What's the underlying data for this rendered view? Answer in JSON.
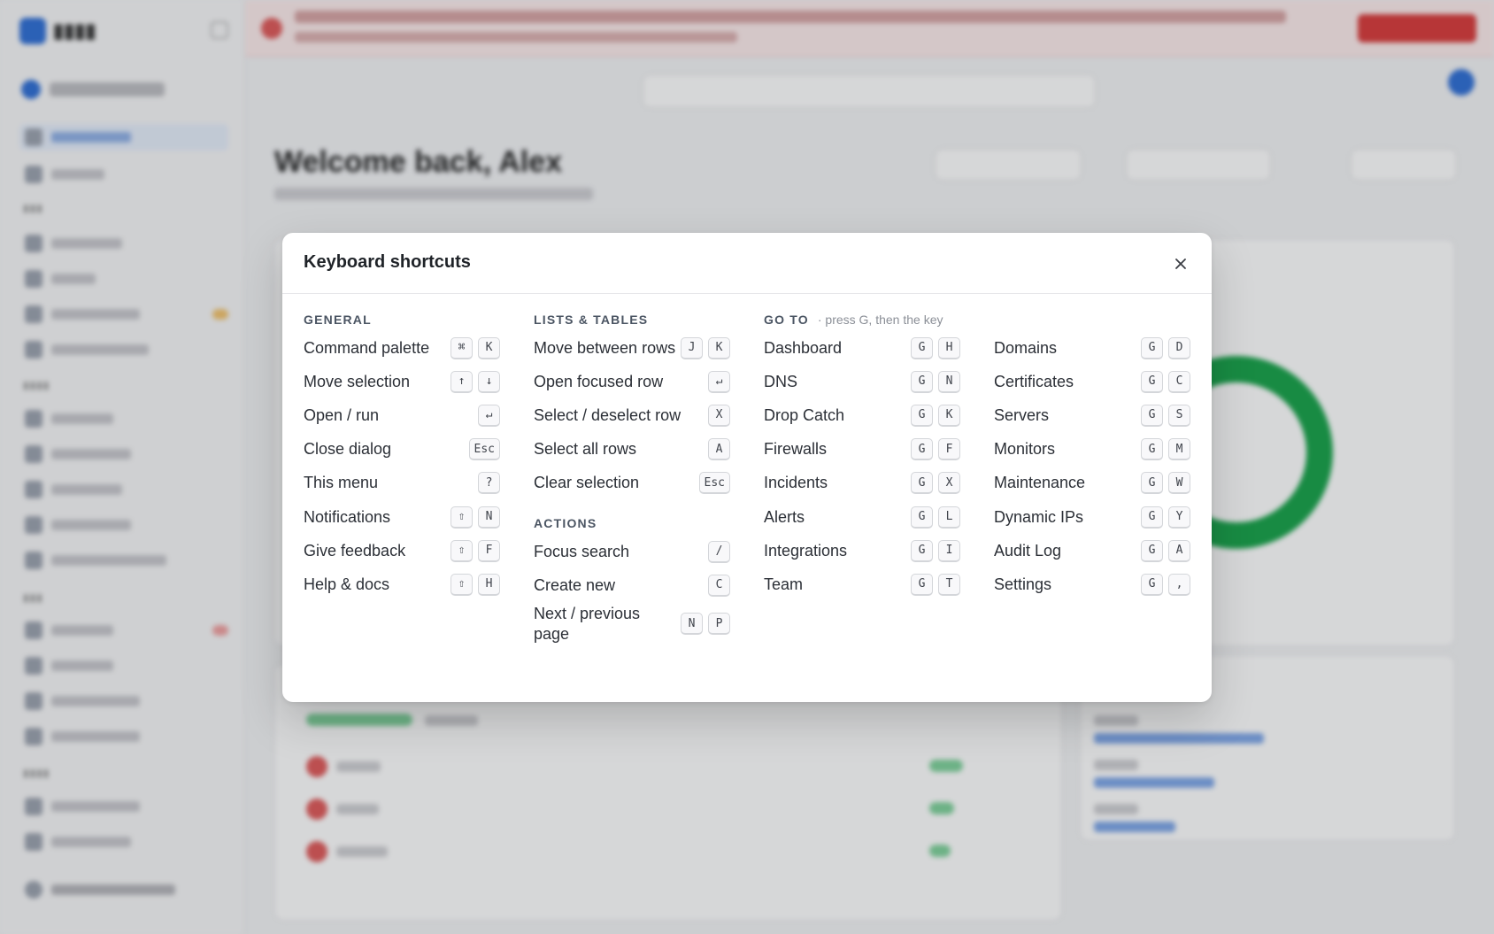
{
  "background": {
    "page_title": "Welcome back, Alex"
  },
  "modal": {
    "title": "Keyboard shortcuts",
    "close_icon": "close-icon",
    "general": {
      "title": "GENERAL",
      "items": [
        {
          "label": "Command palette",
          "keys": [
            "⌘",
            "K"
          ]
        },
        {
          "label": "Move selection",
          "keys": [
            "↑",
            "↓"
          ]
        },
        {
          "label": "Open / run",
          "keys": [
            "↵"
          ]
        },
        {
          "label": "Close dialog",
          "keys": [
            "Esc"
          ]
        },
        {
          "label": "This menu",
          "keys": [
            "?"
          ]
        },
        {
          "label": "Notifications",
          "keys": [
            "⇧",
            "N"
          ]
        },
        {
          "label": "Give feedback",
          "keys": [
            "⇧",
            "F"
          ]
        },
        {
          "label": "Help & docs",
          "keys": [
            "⇧",
            "H"
          ]
        }
      ]
    },
    "lists_tables": {
      "title": "LISTS & TABLES",
      "items": [
        {
          "label": "Move between rows",
          "keys": [
            "J",
            "K"
          ]
        },
        {
          "label": "Open focused row",
          "keys": [
            "↵"
          ]
        },
        {
          "label": "Select / deselect row",
          "keys": [
            "X"
          ]
        },
        {
          "label": "Select all rows",
          "keys": [
            "A"
          ]
        },
        {
          "label": "Clear selection",
          "keys": [
            "Esc"
          ]
        }
      ]
    },
    "actions": {
      "title": "ACTIONS",
      "items": [
        {
          "label": "Focus search",
          "keys": [
            "/"
          ]
        },
        {
          "label": "Create new",
          "keys": [
            "C"
          ]
        },
        {
          "label": "Next / previous page",
          "keys": [
            "N",
            "P"
          ]
        }
      ]
    },
    "go_to": {
      "title": "GO TO",
      "hint": "· press G, then the key",
      "left": [
        {
          "label": "Dashboard",
          "keys": [
            "G",
            "H"
          ]
        },
        {
          "label": "DNS",
          "keys": [
            "G",
            "N"
          ]
        },
        {
          "label": "Drop Catch",
          "keys": [
            "G",
            "K"
          ]
        },
        {
          "label": "Firewalls",
          "keys": [
            "G",
            "F"
          ]
        },
        {
          "label": "Incidents",
          "keys": [
            "G",
            "X"
          ]
        },
        {
          "label": "Alerts",
          "keys": [
            "G",
            "L"
          ]
        },
        {
          "label": "Integrations",
          "keys": [
            "G",
            "I"
          ]
        },
        {
          "label": "Team",
          "keys": [
            "G",
            "T"
          ]
        }
      ],
      "right": [
        {
          "label": "Domains",
          "keys": [
            "G",
            "D"
          ]
        },
        {
          "label": "Certificates",
          "keys": [
            "G",
            "C"
          ]
        },
        {
          "label": "Servers",
          "keys": [
            "G",
            "S"
          ]
        },
        {
          "label": "Monitors",
          "keys": [
            "G",
            "M"
          ]
        },
        {
          "label": "Maintenance",
          "keys": [
            "G",
            "W"
          ]
        },
        {
          "label": "Dynamic IPs",
          "keys": [
            "G",
            "Y"
          ]
        },
        {
          "label": "Audit Log",
          "keys": [
            "G",
            "A"
          ]
        },
        {
          "label": "Settings",
          "keys": [
            "G",
            ","
          ]
        }
      ]
    }
  }
}
